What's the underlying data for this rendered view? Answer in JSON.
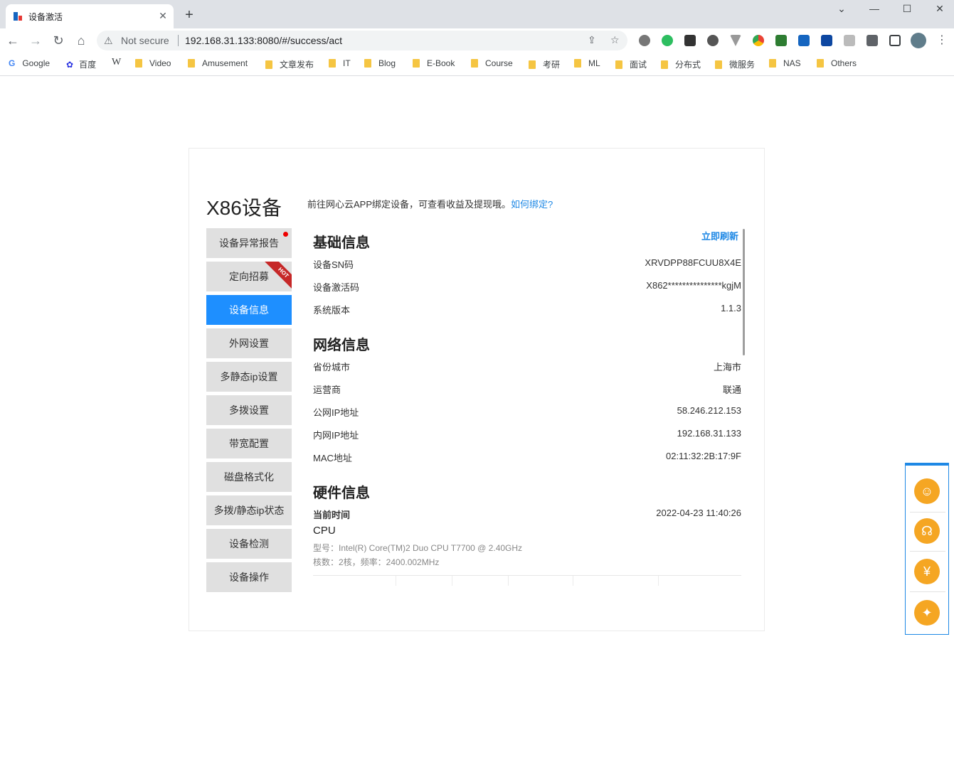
{
  "browser": {
    "tab_title": "设备激活",
    "tab_close": "✕",
    "new_tab": "+",
    "win_minimize": "⌄",
    "win_min": "—",
    "win_max": "☐",
    "win_close": "✕",
    "not_secure": "Not secure",
    "url": "192.168.31.133:8080/#/success/act",
    "bookmarks": [
      "Google",
      "百度",
      "W",
      "Video",
      "Amusement",
      "文章发布",
      "IT",
      "Blog",
      "E-Book",
      "Course",
      "考研",
      "ML",
      "面试",
      "分布式",
      "微服务",
      "NAS",
      "Others"
    ]
  },
  "page": {
    "device_title": "X86设备",
    "intro_text": "前往网心云APP绑定设备，可查看收益及提现哦。",
    "intro_link": "如何绑定?",
    "menu": [
      {
        "label": "设备异常报告"
      },
      {
        "label": "定向招募",
        "badge": "HOT"
      },
      {
        "label": "设备信息"
      },
      {
        "label": "外网设置"
      },
      {
        "label": "多静态ip设置"
      },
      {
        "label": "多拨设置"
      },
      {
        "label": "带宽配置"
      },
      {
        "label": "磁盘格式化"
      },
      {
        "label": "多拨/静态ip状态"
      },
      {
        "label": "设备检测"
      },
      {
        "label": "设备操作"
      }
    ],
    "refresh": "立即刷新",
    "basic": {
      "title": "基础信息",
      "rows": [
        {
          "label": "设备SN码",
          "value": "XRVDPP88FCUU8X4E"
        },
        {
          "label": "设备激活码",
          "value": "X862***************kgjM"
        },
        {
          "label": "系统版本",
          "value": "1.1.3"
        }
      ]
    },
    "network": {
      "title": "网络信息",
      "rows": [
        {
          "label": "省份城市",
          "value": "上海市"
        },
        {
          "label": "运营商",
          "value": "联通"
        },
        {
          "label": "公网IP地址",
          "value": "58.246.212.153"
        },
        {
          "label": "内网IP地址",
          "value": "192.168.31.133"
        },
        {
          "label": "MAC地址",
          "value": "02:11:32:2B:17:9F"
        }
      ]
    },
    "hardware": {
      "title": "硬件信息",
      "time_label": "当前时间",
      "time_value": "2022-04-23 11:40:26",
      "cpu_title": "CPU",
      "cpu_model": "型号：Intel(R) Core(TM)2 Duo CPU T7700 @ 2.40GHz",
      "cpu_cores": "核数：2核，频率：2400.002MHz"
    }
  },
  "side_panel": {
    "icons": [
      "qq-icon",
      "headset-icon",
      "money-bag-icon",
      "lightbulb-icon"
    ],
    "glyphs": [
      "☺",
      "☊",
      "¥",
      "✦"
    ]
  }
}
